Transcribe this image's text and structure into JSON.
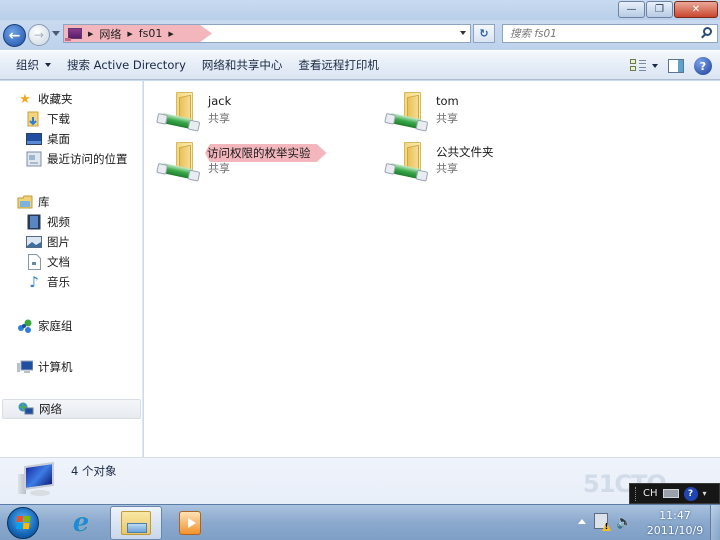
{
  "window": {
    "controls": {
      "minimize": "—",
      "maximize": "❐",
      "close": "✕"
    }
  },
  "nav": {
    "back_icon": "←",
    "forward_icon": "→",
    "breadcrumb": [
      "网络",
      "fs01"
    ],
    "refresh_icon": "↻",
    "search_placeholder": "搜索 fs01"
  },
  "toolbar": {
    "organize": "组织",
    "search_ad": "搜索 Active Directory",
    "network_center": "网络和共享中心",
    "view_printers": "查看远程打印机",
    "help": "?"
  },
  "sidebar": {
    "favorites": {
      "label": "收藏夹",
      "icon": "★",
      "items": [
        {
          "label": "下载",
          "icon": "download-folder"
        },
        {
          "label": "桌面",
          "icon": "desktop"
        },
        {
          "label": "最近访问的位置",
          "icon": "recent-places"
        }
      ]
    },
    "libraries": {
      "label": "库",
      "icon": "library",
      "items": [
        {
          "label": "视频",
          "icon": "video"
        },
        {
          "label": "图片",
          "icon": "pictures"
        },
        {
          "label": "文档",
          "icon": "documents"
        },
        {
          "label": "音乐",
          "icon": "♪"
        }
      ]
    },
    "homegroup": {
      "label": "家庭组",
      "icon": "homegroup"
    },
    "computer": {
      "label": "计算机",
      "icon": "computer"
    },
    "network": {
      "label": "网络",
      "icon": "network",
      "selected": true
    }
  },
  "content": {
    "items": [
      {
        "name": "jack",
        "type": "共享",
        "highlighted": false
      },
      {
        "name": "tom",
        "type": "共享",
        "highlighted": false
      },
      {
        "name": "访问权限的枚举实验",
        "type": "共享",
        "highlighted": true
      },
      {
        "name": "公共文件夹",
        "type": "共享",
        "highlighted": false
      }
    ]
  },
  "details": {
    "count": "4 个对象"
  },
  "taskbar": {
    "ie_icon": "e",
    "clock_time": "11:47",
    "clock_date": "2011/10/9",
    "volume_icon": "🔈"
  },
  "langbar": {
    "lang": "CH",
    "help": "?",
    "options": "▾"
  },
  "watermark": "51CTO"
}
